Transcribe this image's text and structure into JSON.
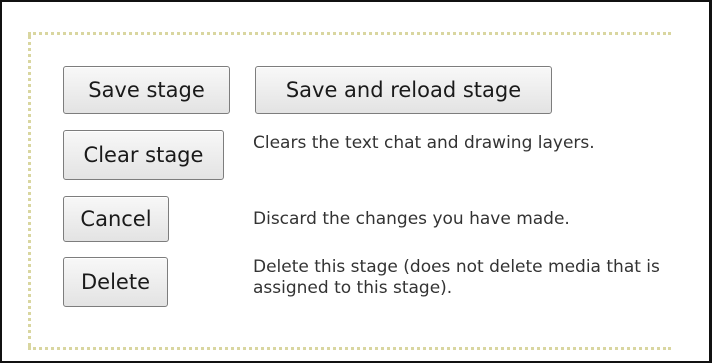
{
  "buttons": {
    "save_stage": "Save stage",
    "save_reload_stage": "Save and reload stage",
    "clear_stage": "Clear stage",
    "cancel": "Cancel",
    "delete": "Delete"
  },
  "descriptions": {
    "clear_stage": "Clears the text chat and drawing layers.",
    "cancel": "Discard the changes you have made.",
    "delete": "Delete this stage (does not delete media that is assigned to this stage)."
  }
}
